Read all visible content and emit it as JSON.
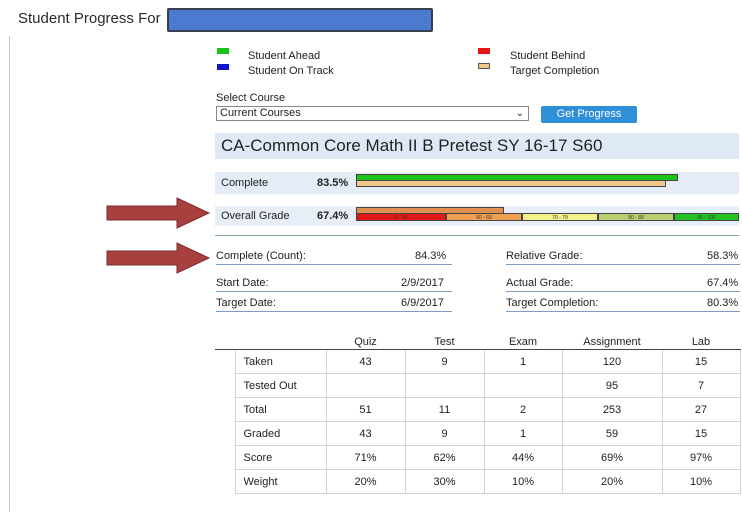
{
  "header": {
    "title": "Student Progress For"
  },
  "legend": [
    {
      "label": "Student Ahead",
      "color": "#19c419"
    },
    {
      "label": "Student On Track",
      "color": "#1515c8"
    },
    {
      "label": "Student Behind",
      "color": "#e01818"
    },
    {
      "label": "Target Completion",
      "color": "#f2c98a"
    }
  ],
  "select": {
    "label": "Select Course",
    "value": "Current Courses",
    "button": "Get Progress"
  },
  "course": {
    "title": "CA-Common Core Math II B Pretest SY 16-17 S60"
  },
  "progress": {
    "complete": {
      "label": "Complete",
      "value": "83.5%",
      "student_pct": 83.5,
      "target_pct": 80.3
    },
    "overall": {
      "label": "Overall Grade",
      "value": "67.4%",
      "scale": [
        "0 - 59",
        "60 - 69",
        "70 - 79",
        "80 - 89",
        "90 - 100"
      ],
      "scale_colors": [
        "#e01818",
        "#f0a050",
        "#f4f08a",
        "#b9cf72",
        "#22c322"
      ]
    }
  },
  "stats": {
    "left": [
      {
        "label": "Complete (Count):",
        "value": "84.3%"
      },
      {
        "label": "Start Date:",
        "value": "2/9/2017"
      },
      {
        "label": "Target Date:",
        "value": "6/9/2017"
      }
    ],
    "right": [
      {
        "label": "Relative Grade:",
        "value": "58.3%"
      },
      {
        "label": "Actual Grade:",
        "value": "67.4%"
      },
      {
        "label": "Target Completion:",
        "value": "80.3%"
      }
    ]
  },
  "table": {
    "columns": [
      "Quiz",
      "Test",
      "Exam",
      "Assignment",
      "Lab"
    ],
    "rows": [
      {
        "label": "Taken",
        "cells": [
          "43",
          "9",
          "1",
          "120",
          "15"
        ]
      },
      {
        "label": "Tested Out",
        "cells": [
          "",
          "",
          "",
          "95",
          "7"
        ]
      },
      {
        "label": "Total",
        "cells": [
          "51",
          "11",
          "2",
          "253",
          "27"
        ]
      },
      {
        "label": "Graded",
        "cells": [
          "43",
          "9",
          "1",
          "59",
          "15"
        ]
      },
      {
        "label": "Score",
        "cells": [
          "71%",
          "62%",
          "44%",
          "69%",
          "97%"
        ]
      },
      {
        "label": "Weight",
        "cells": [
          "20%",
          "30%",
          "10%",
          "20%",
          "10%"
        ]
      }
    ]
  }
}
